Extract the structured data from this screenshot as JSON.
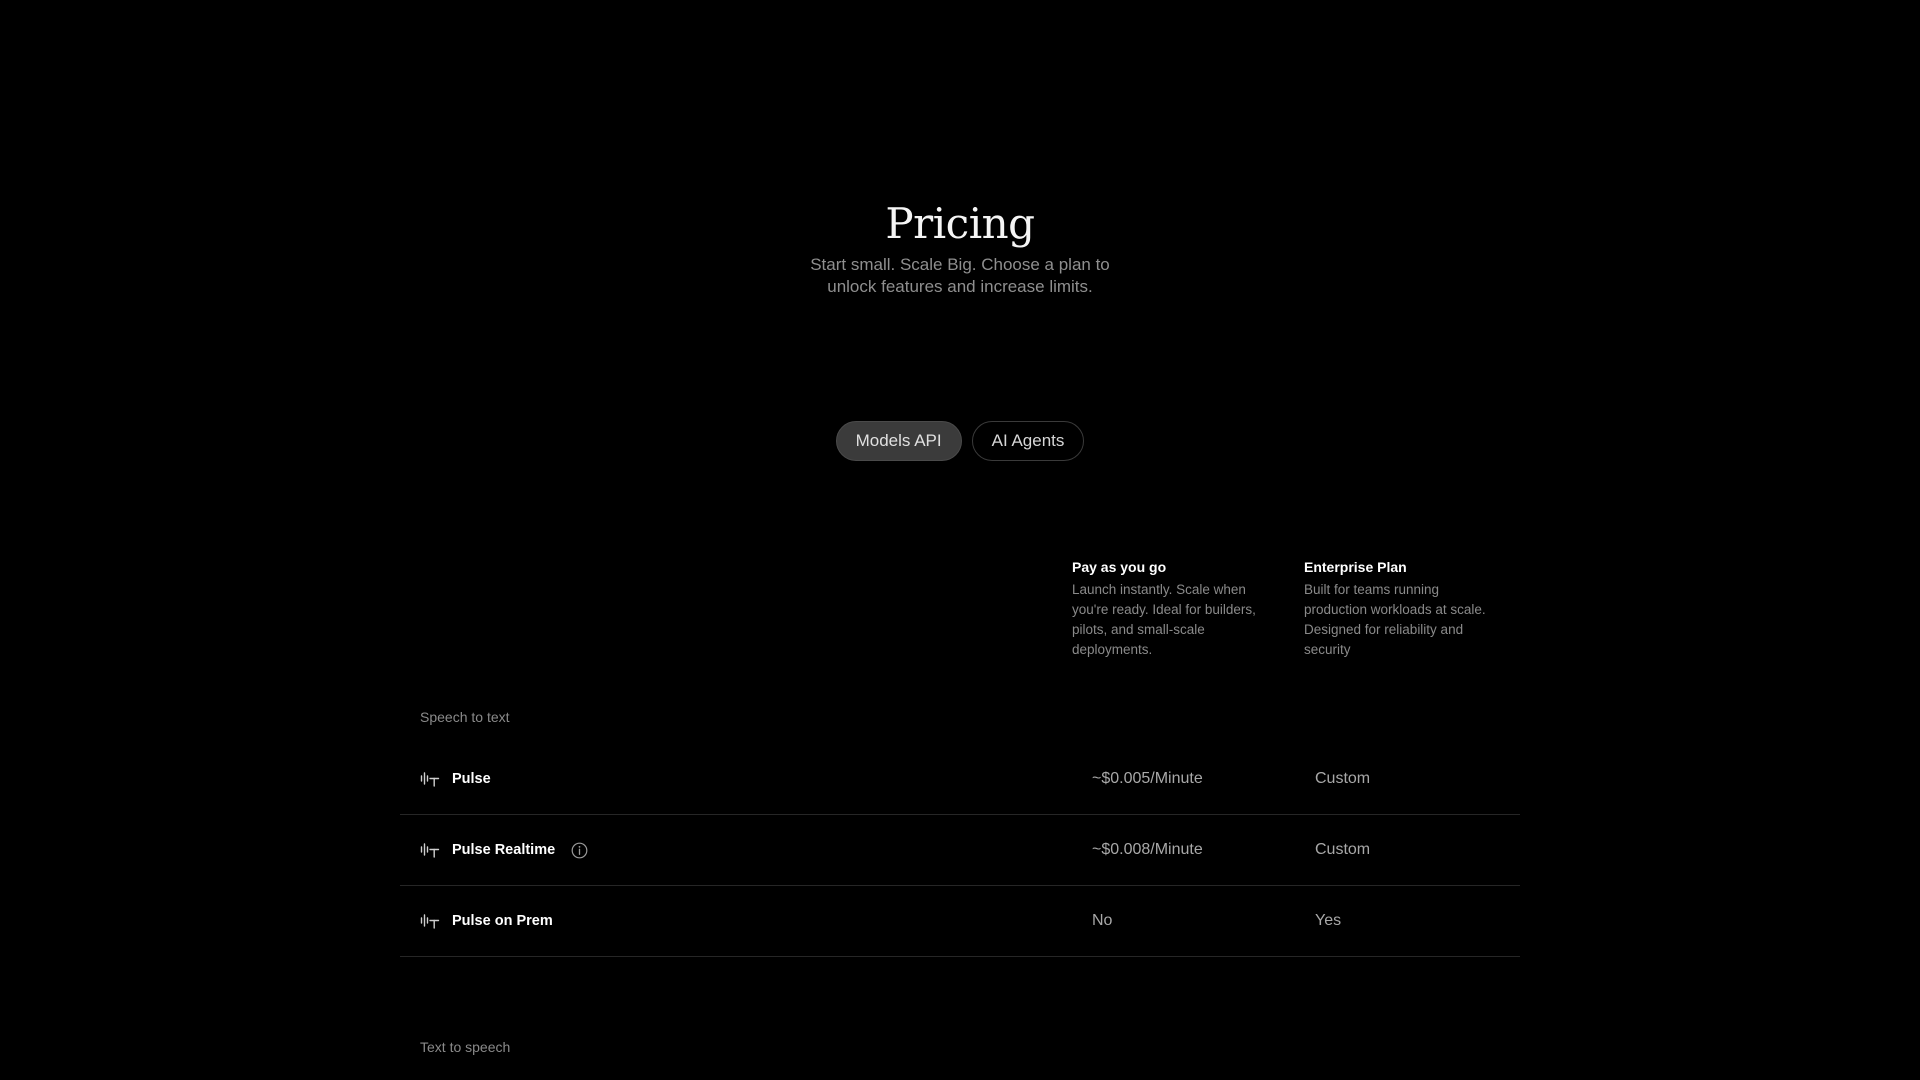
{
  "hero": {
    "title": "Pricing",
    "subtitle": "Start small. Scale Big. Choose a plan to unlock features and increase limits."
  },
  "tabs": [
    {
      "label": "Models API",
      "active": true
    },
    {
      "label": "AI Agents",
      "active": false
    }
  ],
  "plans": [
    {
      "name": "Pay as you go",
      "description": "Launch instantly. Scale when you're ready. Ideal for builders, pilots, and small-scale deployments."
    },
    {
      "name": "Enterprise Plan",
      "description": "Built for teams running production workloads at scale. Designed for reliability and security"
    }
  ],
  "sections": {
    "speech_to_text": {
      "label": "Speech to text",
      "rows": [
        {
          "name": "Pulse",
          "icon": "waveform-text-icon",
          "payg": "~$0.005/Minute",
          "enterprise": "Custom"
        },
        {
          "name": "Pulse Realtime",
          "icon": "waveform-text-icon",
          "info": "info-icon",
          "payg": "~$0.008/Minute",
          "enterprise": "Custom"
        },
        {
          "name": "Pulse on Prem",
          "icon": "waveform-text-icon",
          "payg": "No",
          "enterprise": "Yes"
        }
      ]
    },
    "text_to_speech": {
      "label": "Text to speech"
    }
  },
  "colors": {
    "background": "#000000",
    "muted_text": "#8a8a8a",
    "active_tab": "#3b3b3b",
    "divider": "#262626"
  }
}
